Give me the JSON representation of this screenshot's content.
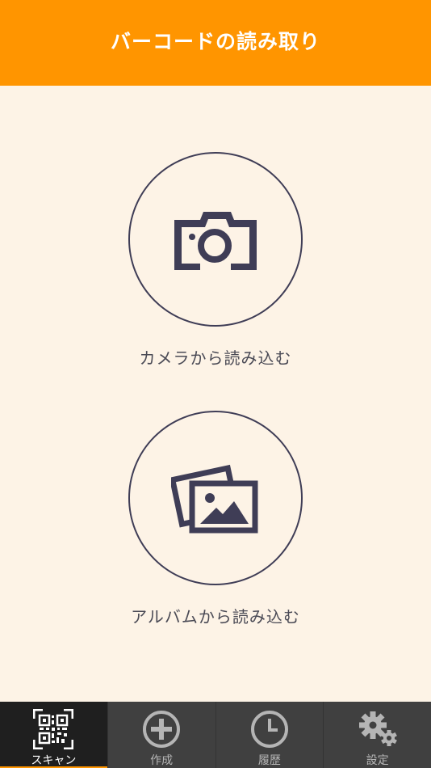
{
  "header": {
    "title": "バーコードの読み取り"
  },
  "actions": {
    "camera": {
      "label": "カメラから読み込む",
      "icon": "camera-icon"
    },
    "album": {
      "label": "アルバムから読み込む",
      "icon": "photos-icon"
    }
  },
  "tabbar": {
    "tabs": [
      {
        "label": "スキャン",
        "icon": "qr-code-icon",
        "active": true
      },
      {
        "label": "作成",
        "icon": "plus-circle-icon",
        "active": false
      },
      {
        "label": "履歴",
        "icon": "clock-icon",
        "active": false
      },
      {
        "label": "設定",
        "icon": "gears-icon",
        "active": false
      }
    ]
  },
  "colors": {
    "accent": "#ff9500",
    "background": "#fdf3e6",
    "icon": "#3f3d56",
    "tabbar": "#404040",
    "tab_active": "#1f1f1f"
  }
}
